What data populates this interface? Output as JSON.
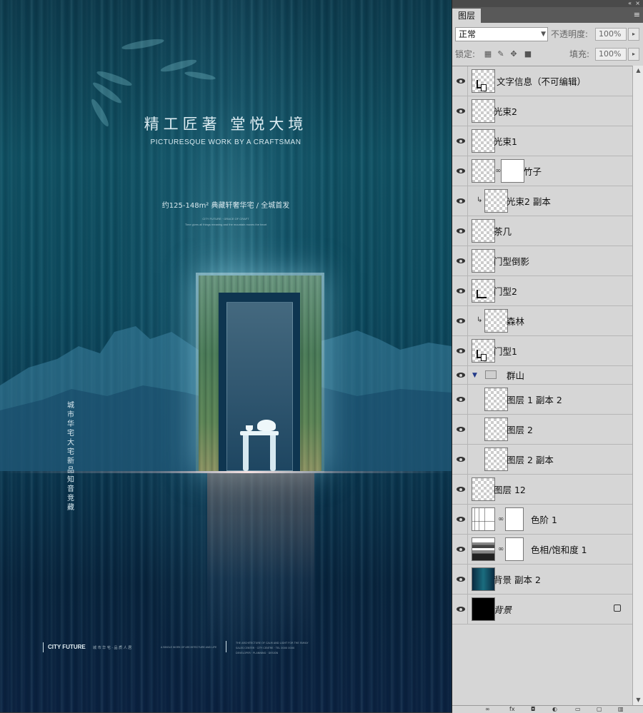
{
  "poster": {
    "title_cn": "精工匠著  堂悦大境",
    "title_en": "PICTURESQUE WORK BY A CRAFTSMAN",
    "spec": "约125-148m² 典藏轩奢华宅 / 全城首发",
    "fine_line_1": "CITY FUTURE · GRACE OF CRAFT",
    "fine_line_2": "Time gives all things meaning and the mountain moves the heart",
    "vertical_text": "城市华宅 大宅新品 知音竞藏",
    "footer_logo": "CITY FUTURE",
    "footer_mid": "城 市 华 宅 · 品 质 人 居",
    "footer_mid2": "A SINGLE WORK OF ARCHITECTURE AND LIFE",
    "footer_right_1": "THE ARCHITECTURE OF CALM AND LIGHT FOR THE FAMILY",
    "footer_right_2": "SALES CENTER · CITY CENTRE · TEL 0000 0000",
    "footer_right_3": "DEVELOPER · PLANNING · DESIGN"
  },
  "panel": {
    "tab_label": "图层",
    "collapse_icon": "«",
    "close_icon": "×",
    "menu_icon": "≡",
    "blend_mode": "正常",
    "opacity_label": "不透明度:",
    "opacity_value": "100%",
    "lock_label": "锁定:",
    "fill_label": "填充:",
    "fill_value": "100%"
  },
  "layers": [
    {
      "name": "文字信息（不可编辑）",
      "thumb": "smart"
    },
    {
      "name": "光束2",
      "thumb": "checker"
    },
    {
      "name": "光束1",
      "thumb": "checker"
    },
    {
      "name": "竹子",
      "thumb": "checker",
      "mask": true
    },
    {
      "name": "光束2 副本",
      "thumb": "checker",
      "clipped": true
    },
    {
      "name": "茶几",
      "thumb": "checker"
    },
    {
      "name": "门型倒影",
      "thumb": "checker"
    },
    {
      "name": "门型2",
      "thumb": "smart"
    },
    {
      "name": "森林",
      "thumb": "checker",
      "clipped": true
    },
    {
      "name": "门型1",
      "thumb": "smart"
    },
    {
      "name": "群山",
      "group": true
    },
    {
      "name": "图层 1 副本 2",
      "thumb": "checker",
      "indent": true
    },
    {
      "name": "图层 2",
      "thumb": "checker",
      "indent": true
    },
    {
      "name": "图层 2 副本",
      "thumb": "checker",
      "indent": true
    },
    {
      "name": "图层 12",
      "thumb": "checker"
    },
    {
      "name": "色阶 1",
      "thumb": "levels",
      "mask": true
    },
    {
      "name": "色相/饱和度 1",
      "thumb": "huesat",
      "mask": true
    },
    {
      "name": "背景 副本 2",
      "thumb": "dark"
    },
    {
      "name": "背景",
      "thumb": "black",
      "locked": true,
      "italic": true
    }
  ],
  "colors": {
    "poster_bg": "#0c4a5e",
    "panel_bg": "#d6d6d6",
    "group_triangle": "#223a8a"
  }
}
